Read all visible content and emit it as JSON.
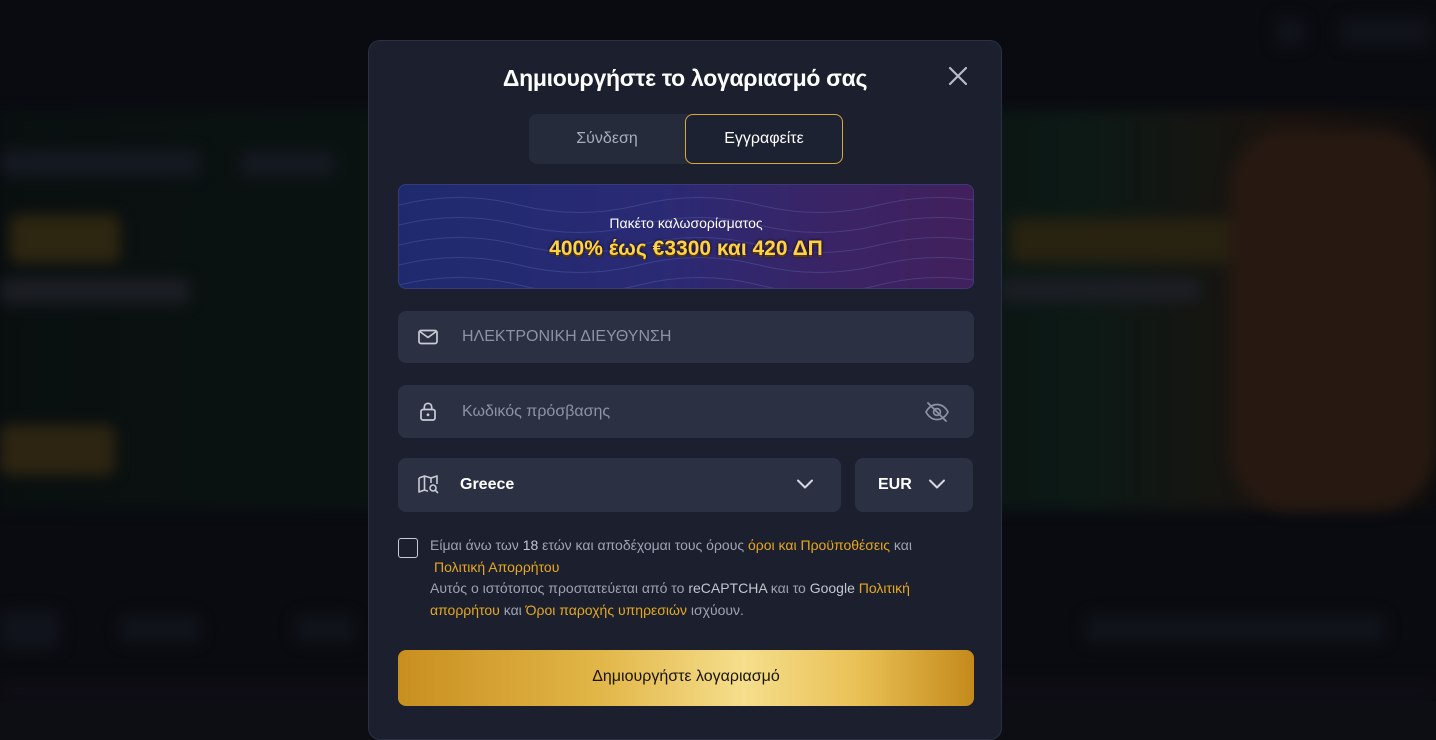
{
  "modal": {
    "title": "Δημιουργήστε το λογαριασμό σας",
    "close_icon": "close-icon"
  },
  "tabs": [
    {
      "label": "Σύνδεση",
      "active": false
    },
    {
      "label": "Εγγραφείτε",
      "active": true
    }
  ],
  "promo": {
    "subtitle": "Πακέτο καλωσορίσματος",
    "headline": "400% έως €3300 και 420 ΔΠ"
  },
  "form": {
    "email": {
      "placeholder": "ΗΛΕΚΤΡΟΝΙΚΗ ΔΙΕΥΘΥΝΣΗ",
      "value": "",
      "icon": "envelope-icon"
    },
    "password": {
      "placeholder": "Κωδικός πρόσβασης",
      "value": "",
      "icon": "lock-icon",
      "toggle_icon": "eye-off-icon"
    },
    "country": {
      "value": "Greece",
      "icon": "map-search-icon"
    },
    "currency": {
      "value": "EUR"
    }
  },
  "consent": {
    "checked": false,
    "line1_a": "Είμαι άνω των",
    "age": "18",
    "line1_b": "ετών και αποδέχομαι τους όρους",
    "terms_link": "όροι και Προϋποθέσεις",
    "and1": "και",
    "privacy_link": "Πολιτική Απορρήτου",
    "recaptcha_a": "Αυτός ο ιστότοπος προστατεύεται από το",
    "recaptcha_brand": "reCAPTCHA",
    "recaptcha_b": "και το",
    "google_brand": "Google",
    "google_privacy_link": "Πολιτική απορρήτου",
    "and2": "και",
    "google_terms_link": "Όροι παροχής υπηρεσιών",
    "recaptcha_c": "ισχύουν."
  },
  "submit": {
    "label": "Δημιουργήστε λογαριασμό"
  },
  "colors": {
    "modal_bg": "#1b1f2e",
    "field_bg": "#2b3043",
    "accent_gold": "#d8a93b",
    "link": "#e6a820",
    "promo_text": "#ffd24a"
  }
}
